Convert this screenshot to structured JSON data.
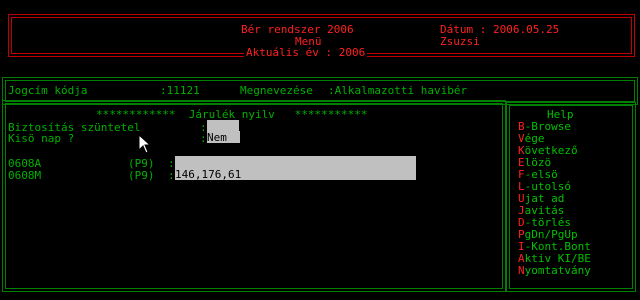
{
  "header": {
    "title": "Bér rendszer 2006",
    "menu": "Menü",
    "year_label": "Aktuális év : 2006",
    "date_label": "Dátum : 2006.05.25",
    "user": "Zsuzsi"
  },
  "record": {
    "code_label": "Jogcím kódja",
    "code_value": ":11121",
    "name_label": "Megnevezése",
    "name_value": ":Alkalmazotti havibér"
  },
  "section": {
    "heading": "************  Járulék nyilv   ***********",
    "insurance_label": "Biztosítás szüntetel",
    "insurance_colon": ":",
    "small_label": "Kisö nap ?",
    "small_colon": ":",
    "small_value": "Nem",
    "rows": [
      {
        "code": "0608A",
        "key": "(P9)",
        "colon": ":",
        "value": ""
      },
      {
        "code": "0608M",
        "key": "(P9)",
        "colon": ":",
        "value": "146,176,61"
      }
    ]
  },
  "help": {
    "title": "Help",
    "items": [
      {
        "key": "B",
        "rest": "-Browse"
      },
      {
        "key": "V",
        "rest": "ége"
      },
      {
        "key": "K",
        "rest": "övetkező"
      },
      {
        "key": "E",
        "rest": "lözö"
      },
      {
        "key": "F",
        "rest": "-elsö"
      },
      {
        "key": "L",
        "rest": "-utolsó"
      },
      {
        "key": "U",
        "rest": "jat ad"
      },
      {
        "key": "J",
        "rest": "avitás"
      },
      {
        "key": "D",
        "rest": "-törlés"
      },
      {
        "key": "P",
        "rest": "gDn/PgUp"
      },
      {
        "key": "I",
        "rest": "-Kont.Bont"
      },
      {
        "key": "A",
        "rest": "ktiv KI/BE"
      },
      {
        "key": "N",
        "rest": "yomtatvány"
      }
    ]
  },
  "colors": {
    "frame_red": "#c00000",
    "text_red": "#ff2020",
    "text_green": "#00b000",
    "field_bg": "#c0c0c0"
  }
}
